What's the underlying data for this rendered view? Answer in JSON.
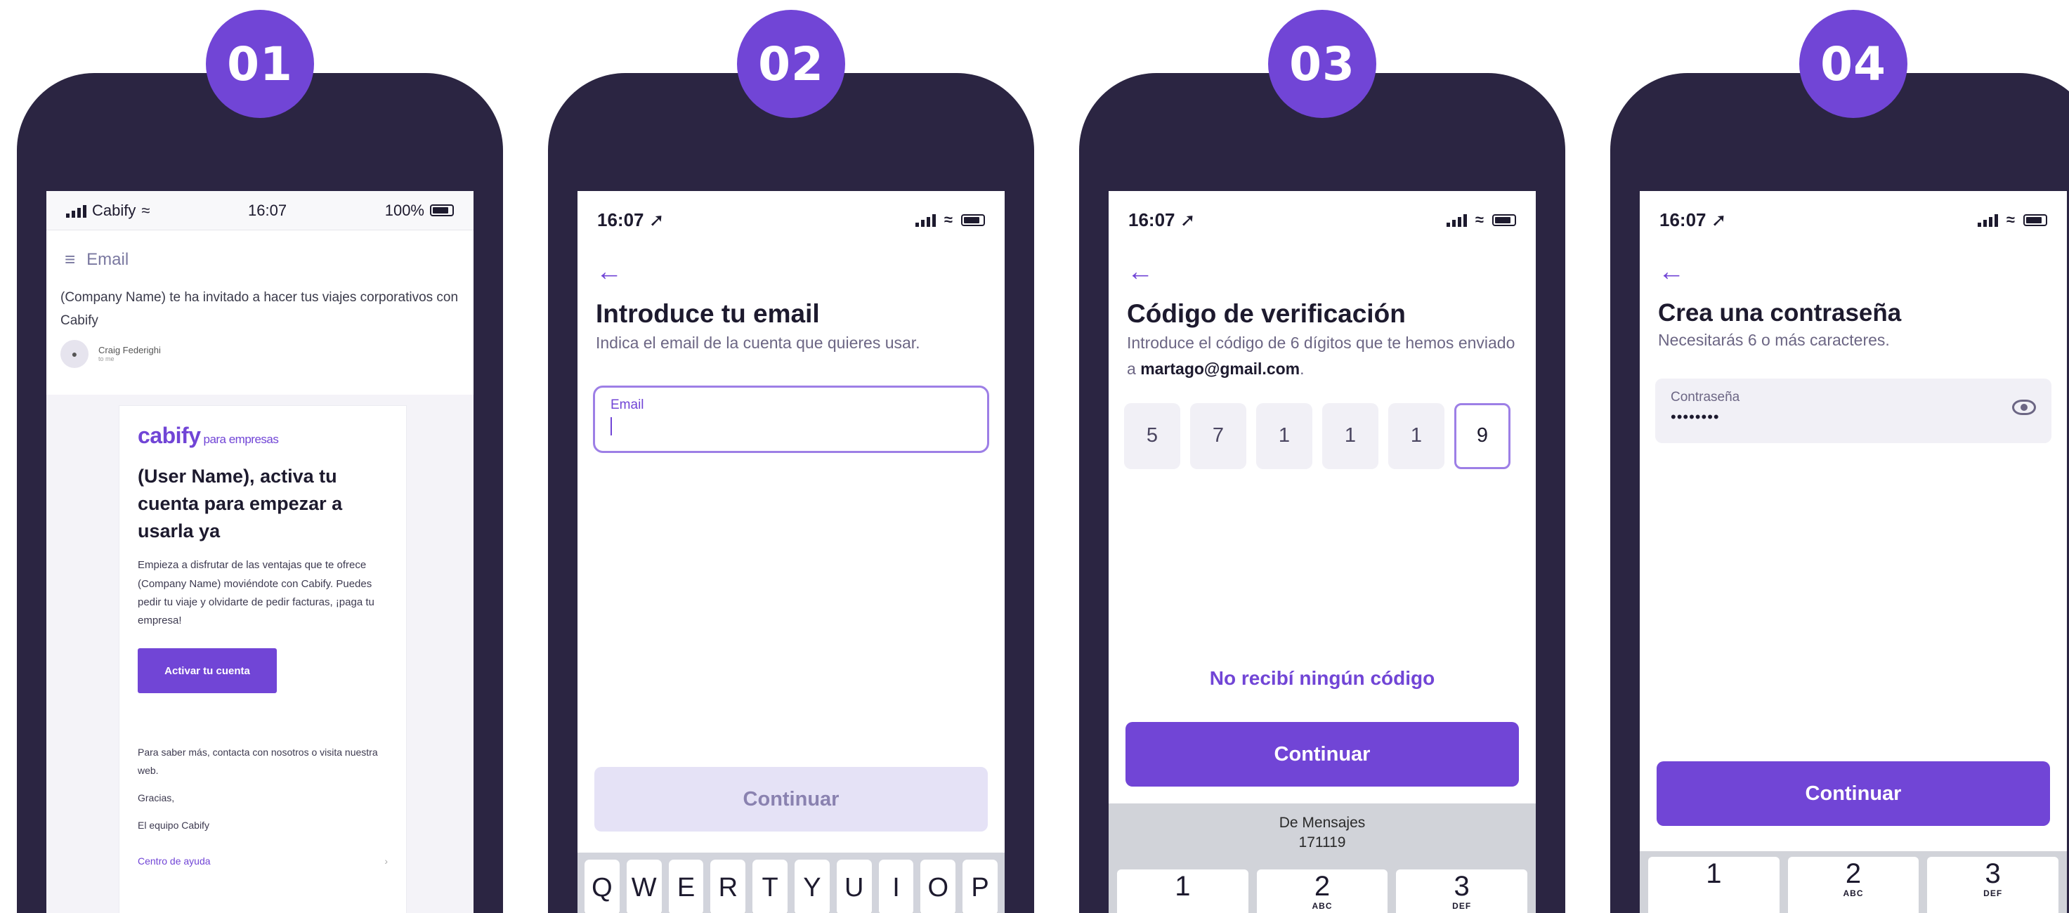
{
  "steps": [
    {
      "badge": "01",
      "status": {
        "carrier": "Cabify",
        "time": "16:07",
        "battery": "100%"
      },
      "mail": {
        "header": "Email",
        "subject": "(Company Name) te ha invitado a hacer tus viajes corporativos con Cabify",
        "sender": "Craig Federighi",
        "sender_sub": "to me",
        "logo": "cabify",
        "logo_suffix": "para empresas",
        "title": "(User Name), activa tu cuenta para empezar a usarla ya",
        "body": "Empieza a disfrutar de las ventajas que te ofrece (Company Name) moviéndote con Cabify. Puedes pedir tu viaje y olvidarte de pedir facturas, ¡paga tu empresa!",
        "button": "Activar tu cuenta",
        "contact": "Para saber más, contacta con nosotros o visita nuestra web.",
        "thanks": "Gracias,",
        "signature": "El equipo Cabify",
        "help_link": "Centro de ayuda",
        "help_chevron": "›"
      }
    },
    {
      "badge": "02",
      "status": {
        "time": "16:07"
      },
      "title": "Introduce tu email",
      "subtitle": "Indica el email de la cuenta que quieres usar.",
      "field_label": "Email",
      "button": "Continuar",
      "keyboard": [
        "Q",
        "W",
        "E",
        "R",
        "T",
        "Y",
        "U",
        "I",
        "O",
        "P"
      ]
    },
    {
      "badge": "03",
      "status": {
        "time": "16:07"
      },
      "title": "Código de verificación",
      "subtitle_pre": "Introduce el código de 6 dígitos que te hemos enviado a ",
      "subtitle_email": "martago@gmail.com",
      "subtitle_post": ".",
      "code": [
        "5",
        "7",
        "1",
        "1",
        "1",
        "9"
      ],
      "resend": "No recibí ningún código",
      "button": "Continuar",
      "suggestion_source": "De Mensajes",
      "suggestion_code": "171119",
      "numpad": [
        {
          "digit": "1",
          "letters": ""
        },
        {
          "digit": "2",
          "letters": "ABC"
        },
        {
          "digit": "3",
          "letters": "DEF"
        }
      ]
    },
    {
      "badge": "04",
      "status": {
        "time": "16:07"
      },
      "title": "Crea una contraseña",
      "subtitle": "Necesitarás 6 o más caracteres.",
      "field_label": "Contraseña",
      "field_value": "••••••••",
      "button": "Continuar",
      "numpad": [
        {
          "digit": "1",
          "letters": ""
        },
        {
          "digit": "2",
          "letters": "ABC"
        },
        {
          "digit": "3",
          "letters": "DEF"
        }
      ]
    }
  ]
}
